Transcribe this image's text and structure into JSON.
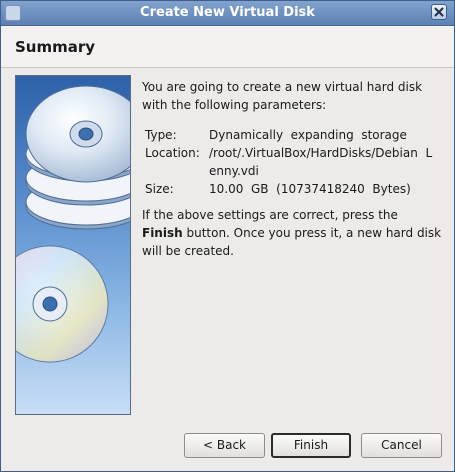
{
  "window": {
    "title": "Create New Virtual Disk"
  },
  "header": {
    "title": "Summary"
  },
  "content": {
    "intro": "You are going to create a new virtual hard disk with the following parameters:",
    "params": [
      {
        "label": "Type:",
        "value": "Dynamically  expanding  storage"
      },
      {
        "label": "Location:",
        "value": "/root/.VirtualBox/HardDisks/Debian  Lenny.vdi"
      },
      {
        "label": "Size:",
        "value": "10.00  GB  (10737418240  Bytes)"
      }
    ],
    "outro_before": "If the above settings are correct, press the ",
    "outro_bold": "Finish",
    "outro_after": " button. Once you press it, a new hard disk will be created."
  },
  "buttons": {
    "back": "< Back",
    "finish": "Finish",
    "cancel": "Cancel"
  },
  "icons": {
    "window": "virtualbox-app-icon",
    "close": "close-icon",
    "side": "disk-stack-illustration"
  }
}
